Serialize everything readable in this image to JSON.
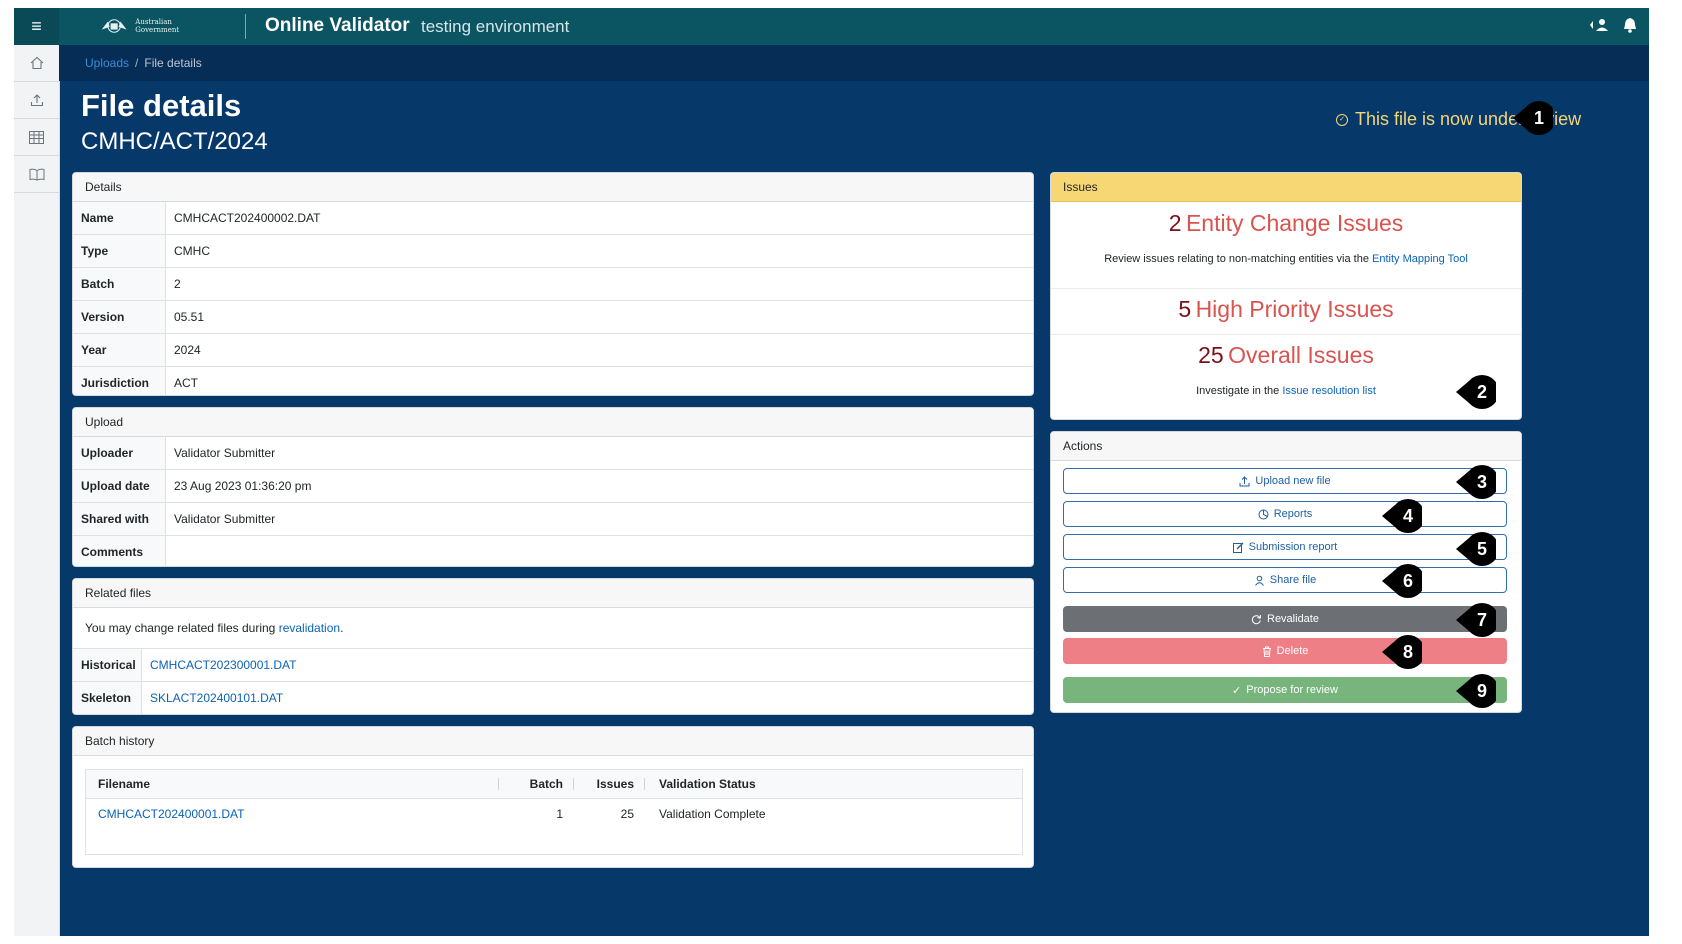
{
  "topbar": {
    "gov_logo_text": "Australian Government",
    "app_title": "Online Validator",
    "app_subtitle": "testing environment"
  },
  "breadcrumb": {
    "link": "Uploads",
    "separator": "/",
    "current": "File details"
  },
  "page": {
    "title": "File details",
    "subtitle": "CMHC/ACT/2024",
    "review_status": "This file is now under review"
  },
  "details": {
    "header": "Details",
    "rows": [
      {
        "key": "Name",
        "value": "CMHCACT202400002.DAT"
      },
      {
        "key": "Type",
        "value": "CMHC"
      },
      {
        "key": "Batch",
        "value": "2"
      },
      {
        "key": "Version",
        "value": "05.51"
      },
      {
        "key": "Year",
        "value": "2024"
      },
      {
        "key": "Jurisdiction",
        "value": "ACT"
      }
    ]
  },
  "upload": {
    "header": "Upload",
    "rows": [
      {
        "key": "Uploader",
        "value": "Validator Submitter"
      },
      {
        "key": "Upload date",
        "value": "23 Aug 2023 01:36:20 pm"
      },
      {
        "key": "Shared with",
        "value": "Validator Submitter"
      },
      {
        "key": "Comments",
        "value": ""
      }
    ]
  },
  "related": {
    "header": "Related files",
    "note_prefix": "You may change related files during",
    "note_link": "revalidation",
    "note_suffix": ".",
    "rows": [
      {
        "key": "Historical",
        "value": "CMHCACT202300001.DAT"
      },
      {
        "key": "Skeleton",
        "value": "SKLACT202400101.DAT"
      }
    ]
  },
  "batch_history": {
    "header": "Batch history",
    "columns": {
      "filename": "Filename",
      "batch": "Batch",
      "issues": "Issues",
      "status": "Validation Status"
    },
    "rows": [
      {
        "filename": "CMHCACT202400001.DAT",
        "batch": "1",
        "issues": "25",
        "status": "Validation Complete"
      }
    ]
  },
  "issues": {
    "header": "Issues",
    "entity": {
      "count": "2",
      "label": "Entity Change Issues",
      "note_prefix": "Review issues relating to non-matching entities via the",
      "note_link": "Entity Mapping Tool"
    },
    "high": {
      "count": "5",
      "label": "High Priority Issues"
    },
    "overall": {
      "count": "25",
      "label": "Overall Issues",
      "note_prefix": "Investigate in the",
      "note_link": "Issue resolution list"
    }
  },
  "actions": {
    "header": "Actions",
    "upload_new_file": "Upload new file",
    "reports": "Reports",
    "submission_report": "Submission report",
    "share_file": "Share file",
    "revalidate": "Revalidate",
    "delete": "Delete",
    "propose_for_review": "Propose for review"
  },
  "markers": [
    "1",
    "2",
    "3",
    "4",
    "5",
    "6",
    "7",
    "8",
    "9"
  ],
  "colors": {
    "topbar": "#0b5563",
    "page_bg": "#07386a",
    "review_status": "#f3d57a",
    "issues_header": "#f7d774",
    "issue_count": "#7a1018",
    "issue_label": "#d9534f",
    "revalidate": "#6c6f73",
    "delete": "#ee7f86",
    "propose": "#77b57d",
    "link": "#0b63b6"
  }
}
